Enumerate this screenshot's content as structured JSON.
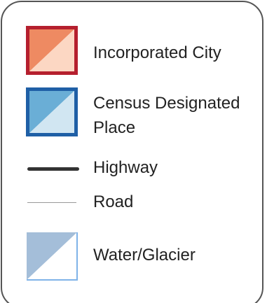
{
  "legend": {
    "items": [
      {
        "key": "incorporated_city",
        "label": "Incorporated City",
        "symbol": "swatch",
        "colors": {
          "fill_dark": "#ee8a62",
          "fill_light": "#fcd7c3",
          "border": "#b51f2e"
        }
      },
      {
        "key": "census_designated_place",
        "label_lines": [
          "Census Designated",
          "Place"
        ],
        "symbol": "swatch",
        "colors": {
          "fill_dark": "#6aaed6",
          "fill_light": "#d1e6f2",
          "border": "#1f5fa6"
        }
      },
      {
        "key": "highway",
        "label": "Highway",
        "symbol": "thick-line",
        "colors": {
          "line": "#333333"
        }
      },
      {
        "key": "road",
        "label": "Road",
        "symbol": "thin-line",
        "colors": {
          "line": "#999999"
        }
      },
      {
        "key": "water_glacier",
        "label": "Water/Glacier",
        "symbol": "swatch",
        "colors": {
          "fill_dark": "#a4bed9",
          "fill_light": "#ffffff",
          "border": "#7fb3e8"
        }
      }
    ]
  }
}
